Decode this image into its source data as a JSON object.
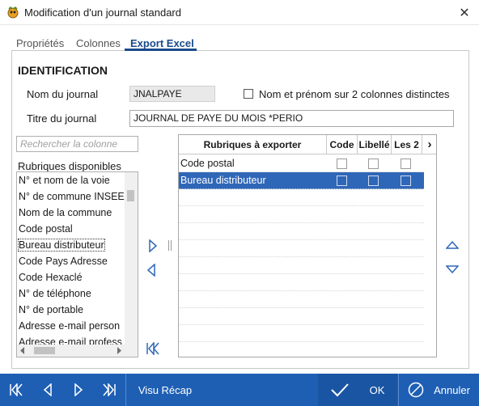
{
  "window": {
    "title": "Modification d'un journal standard",
    "close_glyph": "✕"
  },
  "tabs": [
    {
      "label": "Propriétés"
    },
    {
      "label": "Colonnes"
    },
    {
      "label": "Export Excel"
    }
  ],
  "identification": {
    "heading": "IDENTIFICATION",
    "nom_label": "Nom du journal",
    "nom_value": "JNALPAYE",
    "checkbox_label": "Nom et prénom sur 2 colonnes distinctes",
    "titre_label": "Titre du journal",
    "titre_value": "JOURNAL DE PAYE DU MOIS *PERIO"
  },
  "search": {
    "placeholder": "Rechercher la colonne"
  },
  "available": {
    "label": "Rubriques disponibles",
    "items": [
      "N° et nom de la voie",
      "N° de commune INSEE",
      "Nom de la commune",
      "Code postal",
      "Bureau distributeur",
      "Code Pays Adresse",
      "Code Hexaclé",
      "N° de téléphone",
      "N° de portable",
      "Adresse e-mail person",
      "Adresse e-mail profess"
    ]
  },
  "export_grid": {
    "headers": [
      "Rubriques à exporter",
      "Code",
      "Libellé",
      "Les 2"
    ],
    "more_glyph": "›",
    "rows": [
      {
        "label": "Code postal"
      },
      {
        "label": "Bureau distributeur"
      }
    ]
  },
  "footer": {
    "visu_label": "Visu Récap",
    "ok_label": "OK",
    "cancel_label": "Annuler"
  },
  "colors": {
    "accent": "#1e5fb4",
    "selection": "#2f67b8",
    "tab_active": "#1a4a8a"
  }
}
